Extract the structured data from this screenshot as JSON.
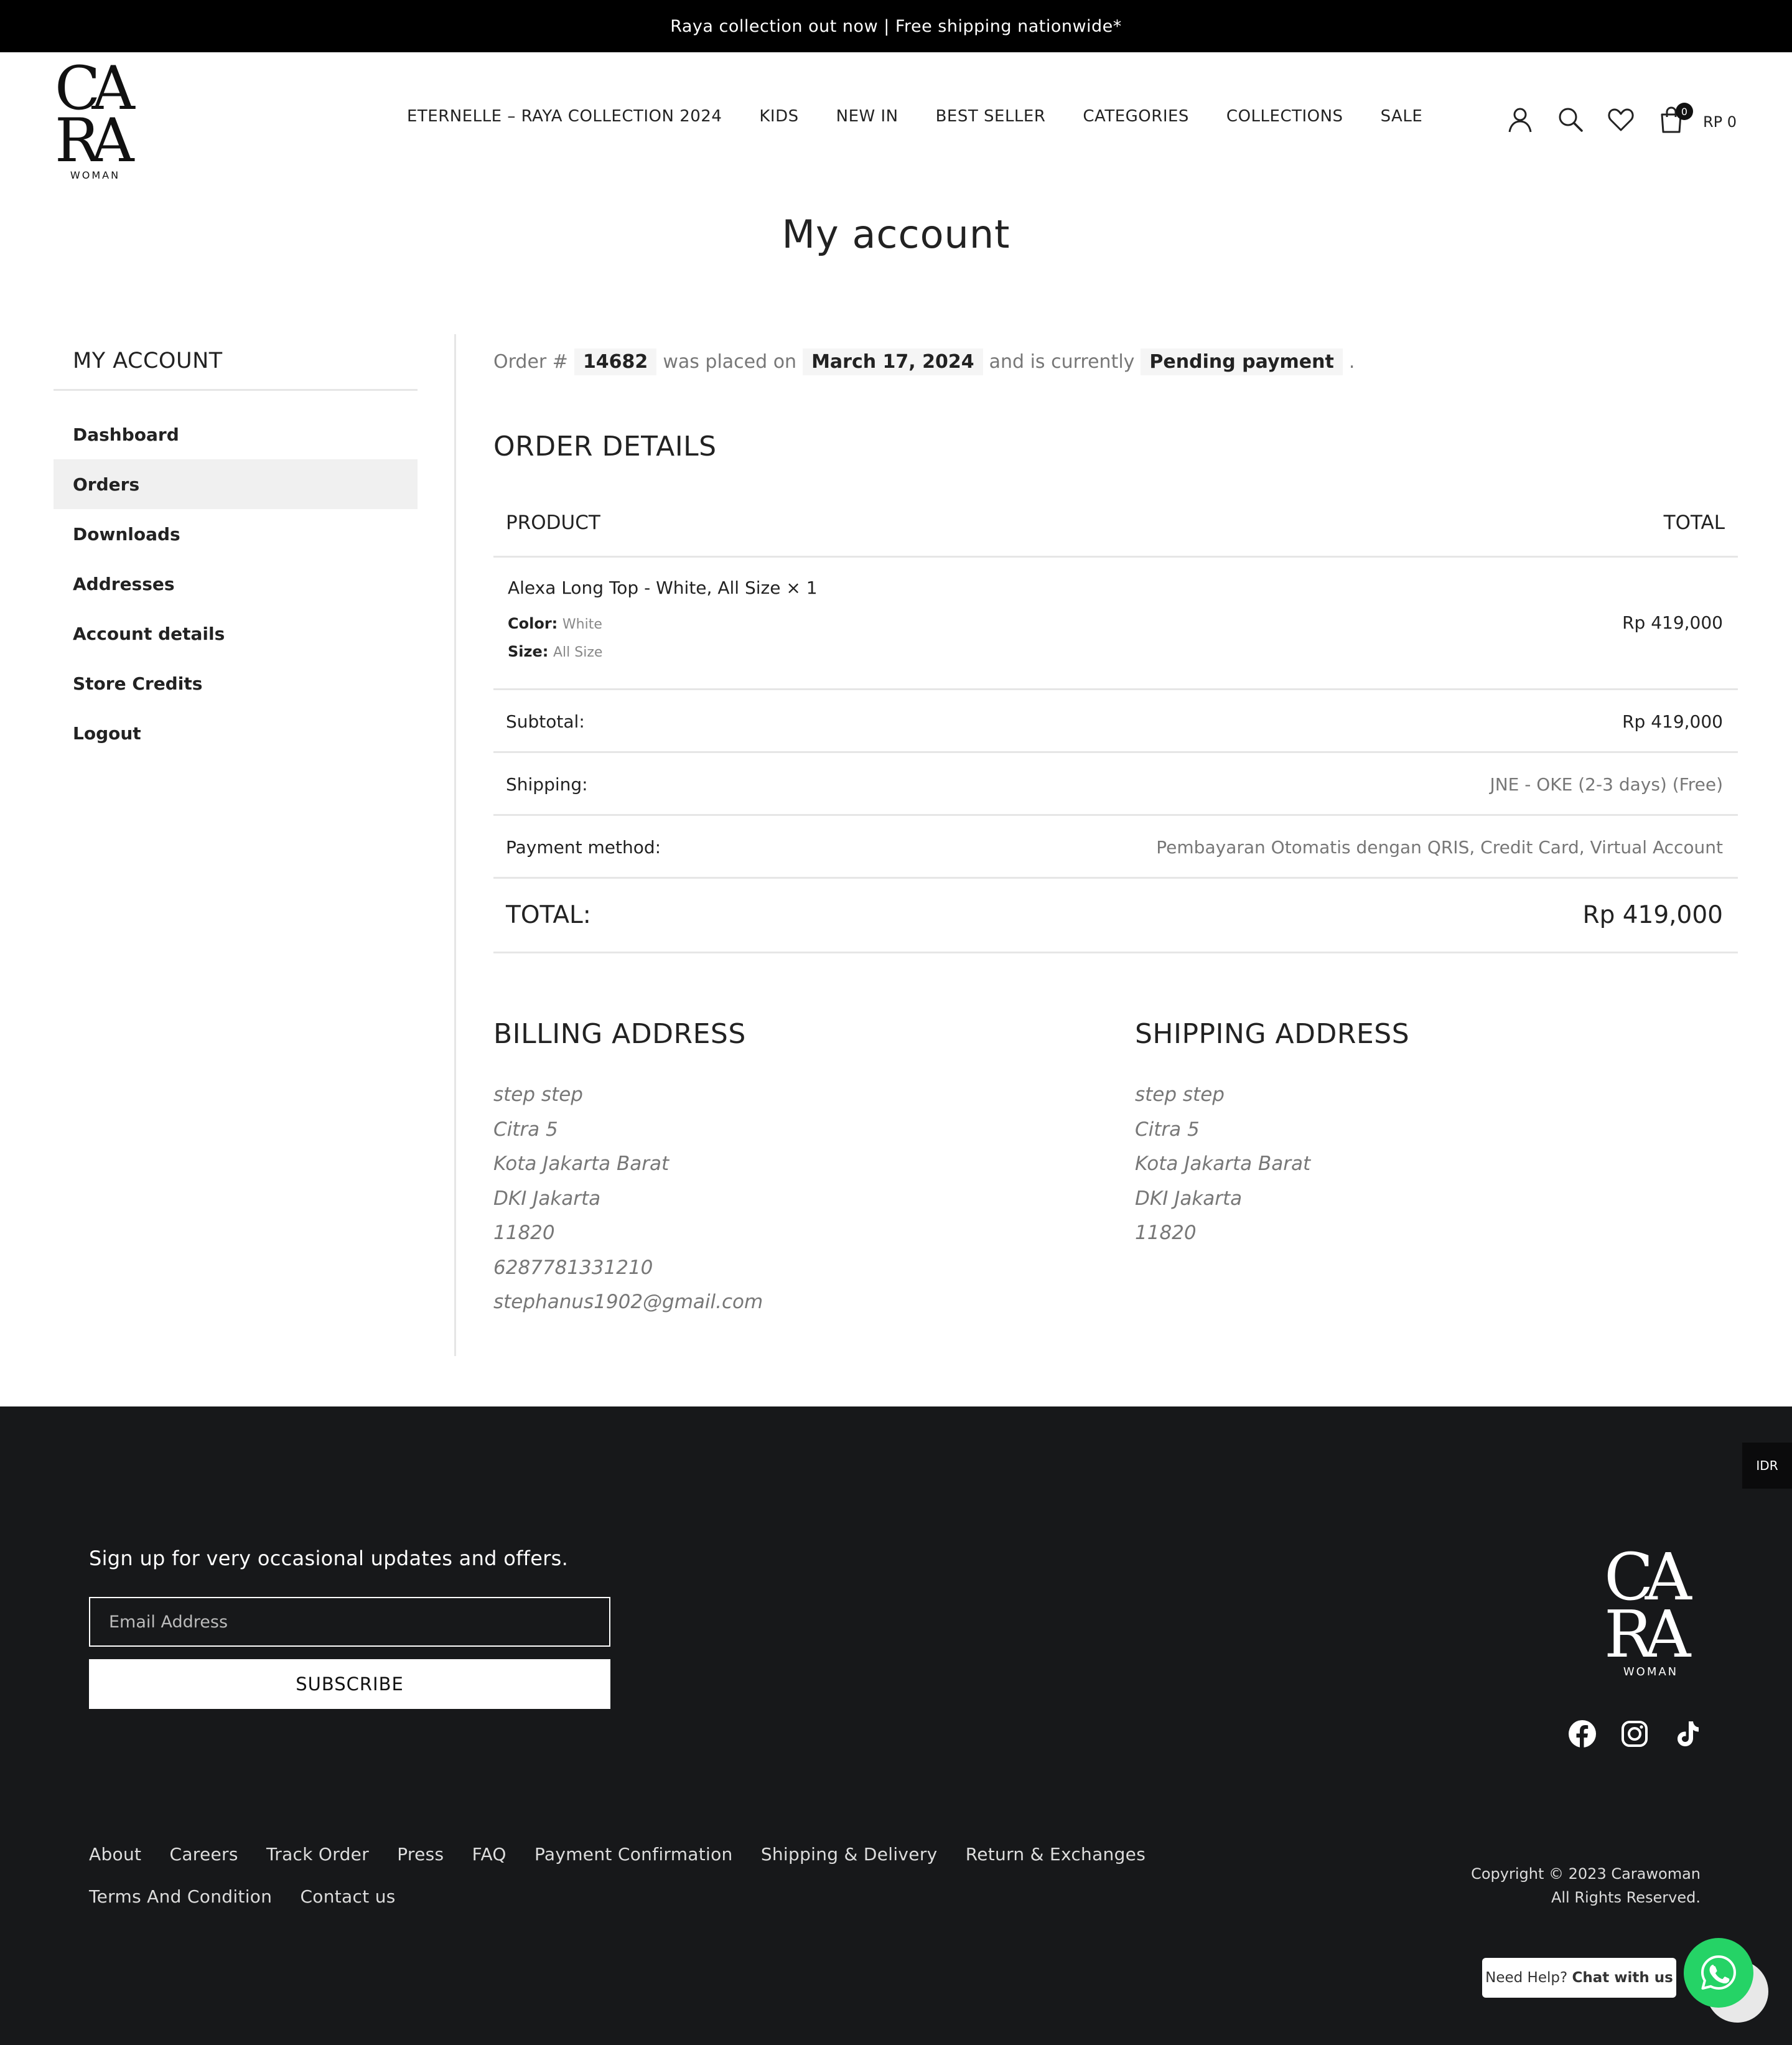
{
  "announcement": "Raya collection out now | Free shipping nationwide*",
  "brand": {
    "logo_text": "CARA",
    "logo_sub": "WOMAN"
  },
  "nav": [
    "ETERNELLE – RAYA COLLECTION 2024",
    "KIDS",
    "NEW IN",
    "BEST SELLER",
    "CATEGORIES",
    "COLLECTIONS",
    "SALE"
  ],
  "header": {
    "cart_count": "0",
    "cart_total": "RP 0",
    "icons": [
      "user-icon",
      "search-icon",
      "heart-icon",
      "shopping-bag-icon"
    ]
  },
  "page_title": "My account",
  "sidebar": {
    "title": "MY ACCOUNT",
    "items": [
      {
        "label": "Dashboard",
        "active": false
      },
      {
        "label": "Orders",
        "active": true
      },
      {
        "label": "Downloads",
        "active": false
      },
      {
        "label": "Addresses",
        "active": false
      },
      {
        "label": "Account details",
        "active": false
      },
      {
        "label": "Store Credits",
        "active": false
      },
      {
        "label": "Logout",
        "active": false
      }
    ]
  },
  "order": {
    "prefix": "Order #",
    "number": "14682",
    "placed_text": "was placed on",
    "date": "March 17, 2024",
    "status_text": "and is currently",
    "status": "Pending payment",
    "period": "."
  },
  "order_details": {
    "title": "ORDER DETAILS",
    "col_product": "PRODUCT",
    "col_total": "TOTAL",
    "item": {
      "name": "Alexa Long Top - White, All Size",
      "qty": "× 1",
      "color_label": "Color:",
      "color_value": "White",
      "size_label": "Size:",
      "size_value": "All Size",
      "price": "Rp 419,000"
    },
    "subtotal_label": "Subtotal:",
    "subtotal_value": "Rp 419,000",
    "shipping_label": "Shipping:",
    "shipping_value": "JNE - OKE (2-3 days) (Free)",
    "payment_label": "Payment method:",
    "payment_value": "Pembayaran Otomatis dengan QRIS, Credit Card, Virtual Account",
    "total_label": "TOTAL:",
    "total_value": "Rp 419,000"
  },
  "billing": {
    "title": "BILLING ADDRESS",
    "lines": [
      "step step",
      "Citra 5",
      "Kota Jakarta Barat",
      "DKI Jakarta",
      "11820",
      "6287781331210",
      "stephanus1902@gmail.com"
    ]
  },
  "shipping": {
    "title": "SHIPPING ADDRESS",
    "lines": [
      "step step",
      "Citra 5",
      "Kota Jakarta Barat",
      "DKI Jakarta",
      "11820"
    ]
  },
  "footer": {
    "currency_tab": "IDR",
    "signup_text": "Sign up for very occasional updates and offers.",
    "email_placeholder": "Email Address",
    "subscribe_label": "SUBSCRIBE",
    "social_icons": [
      "facebook-icon",
      "instagram-icon",
      "tiktok-icon"
    ],
    "links": [
      "About",
      "Careers",
      "Track Order",
      "Press",
      "FAQ",
      "Payment Confirmation",
      "Shipping & Delivery",
      "Return & Exchanges",
      "Terms And Condition",
      "Contact us"
    ],
    "copyright_line1": "Copyright © 2023 Carawoman",
    "copyright_line2": "All Rights Reserved."
  },
  "chat": {
    "prefix": "Need Help?",
    "cta": "Chat with us"
  },
  "colors": {
    "footer_bg": "#17181a",
    "topbar_bg": "#000000",
    "whatsapp": "#25d366",
    "active_row": "#f0f0f0"
  }
}
